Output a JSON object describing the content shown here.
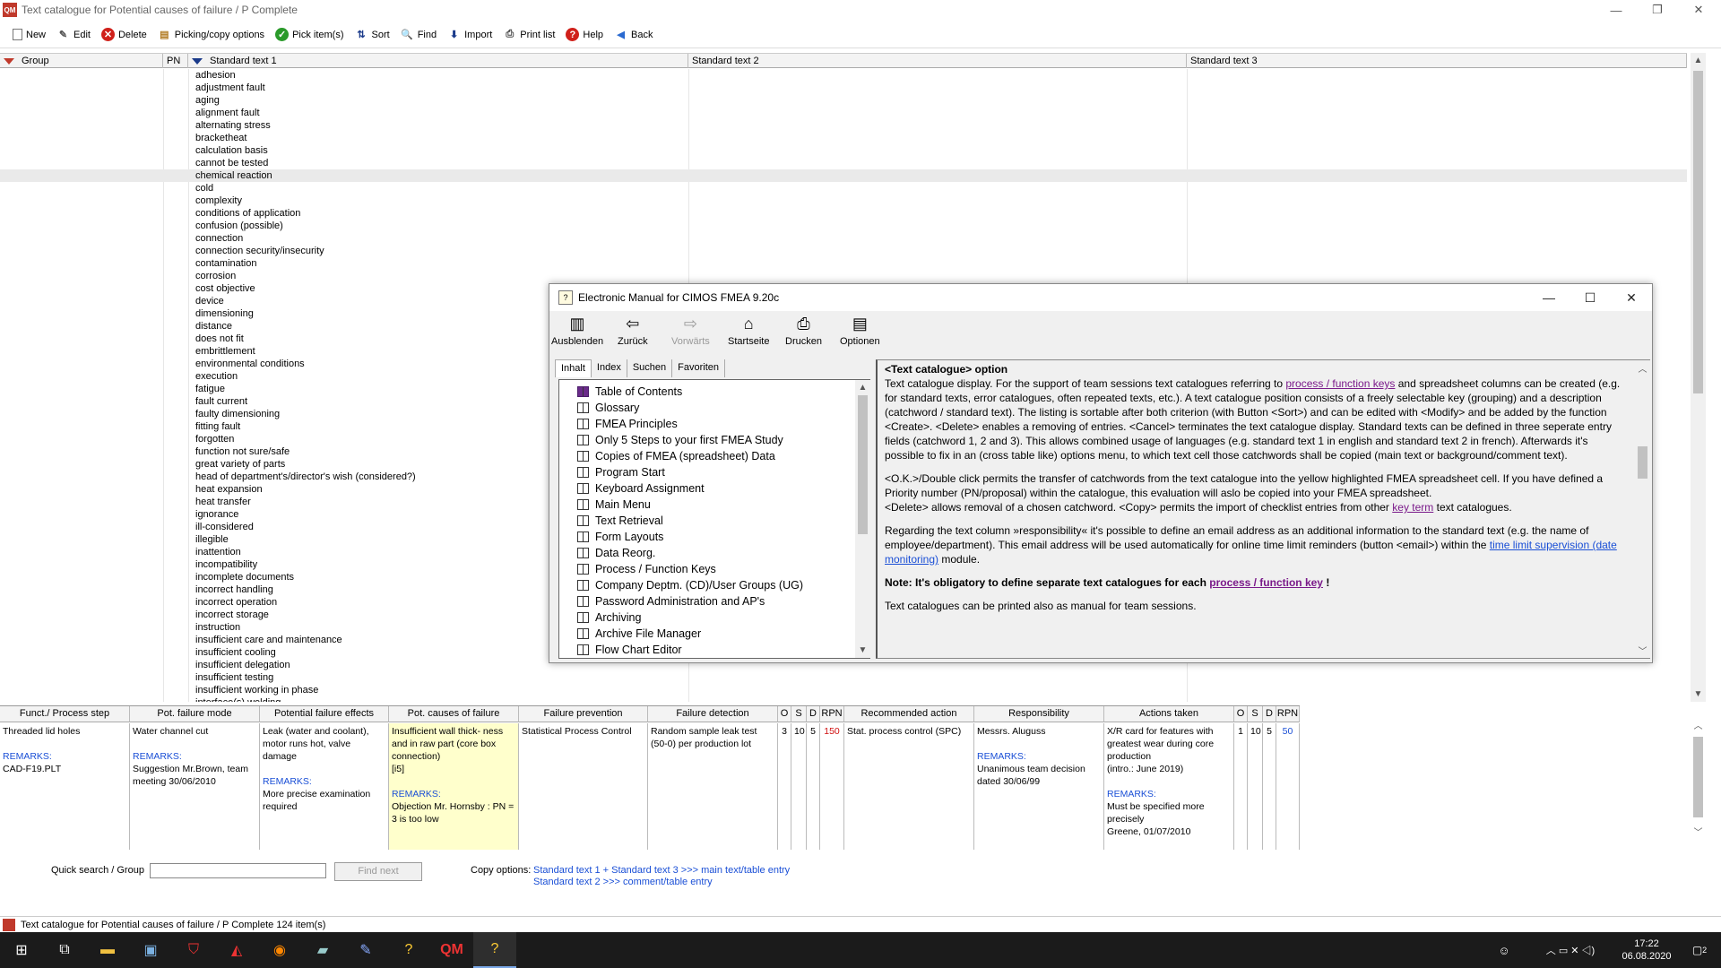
{
  "window": {
    "title": "Text catalogue for Potential causes of failure / P  Complete",
    "app_icon": "QM"
  },
  "toolbar": [
    {
      "label": "New",
      "icon": "new-icon"
    },
    {
      "label": "Edit",
      "icon": "edit-icon"
    },
    {
      "label": "Delete",
      "icon": "delete-icon"
    },
    {
      "label": "Picking/copy options",
      "icon": "picking-icon"
    },
    {
      "label": "Pick item(s)",
      "icon": "pick-icon"
    },
    {
      "label": "Sort",
      "icon": "sort-icon"
    },
    {
      "label": "Find",
      "icon": "find-icon"
    },
    {
      "label": "Import",
      "icon": "import-icon"
    },
    {
      "label": "Print list",
      "icon": "print-icon"
    },
    {
      "label": "Help",
      "icon": "help-icon"
    },
    {
      "label": "Back",
      "icon": "back-icon"
    }
  ],
  "grid": {
    "headers": {
      "group": "Group",
      "pn": "PN",
      "st1": "Standard text 1",
      "st2": "Standard text 2",
      "st3": "Standard text 3"
    },
    "rows": [
      "adhesion",
      "adjustment fault",
      "aging",
      "alignment fault",
      "alternating stress",
      "bracketheat",
      "calculation basis",
      "cannot be tested",
      "chemical reaction",
      "cold",
      "complexity",
      "conditions of application",
      "confusion (possible)",
      "connection",
      "connection security/insecurity",
      "contamination",
      "corrosion",
      "cost objective",
      "device",
      "dimensioning",
      "distance",
      "does not fit",
      "embrittlement",
      "environmental conditions",
      "execution",
      "fatigue",
      "fault current",
      "faulty dimensioning",
      "fitting fault",
      "forgotten",
      "function not sure/safe",
      "great variety of parts",
      "head of department's/director's wish (considered?)",
      "heat expansion",
      "heat transfer",
      "ignorance",
      "ill-considered",
      "illegible",
      "inattention",
      "incompatibility",
      "incomplete documents",
      "incorrect handling",
      "incorrect operation",
      "incorrect storage",
      "instruction",
      "insufficient care and maintenance",
      "insufficient cooling",
      "insufficient delegation",
      "insufficient testing",
      "insufficient working in phase",
      "interface(s) welding"
    ],
    "selected_index": 8
  },
  "help": {
    "title": "Electronic Manual for CIMOS FMEA 9.20c",
    "toolbar": [
      "Ausblenden",
      "Zurück",
      "Vorwärts",
      "Startseite",
      "Drucken",
      "Optionen"
    ],
    "tabs": [
      "Inhalt",
      "Index",
      "Suchen",
      "Favoriten"
    ],
    "toc": [
      "Table of Contents",
      "Glossary",
      "FMEA Principles",
      "Only 5 Steps to your first FMEA Study",
      "Copies of FMEA (spreadsheet) Data",
      "Program Start",
      "Keyboard Assignment",
      "Main Menu",
      "Text Retrieval",
      "Form Layouts",
      "Data Reorg.",
      "Process / Function Keys",
      "Company Deptm. (CD)/User Groups (UG)",
      "Password Administration and AP's",
      "Archiving",
      "Archive File Manager",
      "Flow Chart Editor"
    ],
    "content": {
      "heading": "<Text catalogue> option",
      "p1a": "Text catalogue display. For the support of team sessions text catalogues referring to ",
      "p1link": "process / function keys",
      "p1b": " and spreadsheet columns can be created (e.g. for standard texts, error catalogues, often repeated texts, etc.). A text catalogue position consists of a freely selectable key (grouping) and a description (catchword / standard text). The listing is sortable after both criterion (with Button <Sort>) and can be edited with <Modify> and be added by the function <Create>. <Delete> enables a removing of entries. <Cancel> terminates the text catalogue display. Standard texts can be defined in three seperate entry fields (catchword 1, 2 and 3). This allows combined usage of languages (e.g. standard text 1 in english and standard text 2 in french). Afterwards it's possible to fix in an (cross table like)  options menu, to which text cell those catchwords shall be copied (main text or background/comment text).",
      "p2a": "<O.K.>/Double click permits the transfer of catchwords from the text catalogue into the yellow highlighted FMEA spreadsheet cell. If you have defined a Priority number (PN/proposal) within the catalogue, this evaluation will aslo be copied into your FMEA spreadsheet.",
      "p2b": "<Delete> allows removal of a chosen catchword. <Copy> permits the import of checklist entries from other ",
      "p2link": "key term",
      "p2c": " text catalogues.",
      "p3a": "Regarding the text column »responsibility« it's possible to define an email address as an additional information to the standard text (e.g. the name of employee/department). This email address will be used automatically for online time limit reminders (button <email>) within the ",
      "p3link": "time limit supervision (date monitoring)",
      "p3b": " module.",
      "p4a": "Note: It's obligatory to define separate text catalogues for each ",
      "p4link": "process / function key",
      "p4b": " !",
      "p5": "Text catalogues can be printed also as manual for team sessions."
    }
  },
  "fmea": {
    "headers": [
      "Funct./ Process step",
      "Pot. failure mode",
      "Potential failure effects",
      "Pot. causes of failure",
      "Failure prevention",
      "Failure detection",
      "O",
      "S",
      "D",
      "RPN",
      "Recommended action",
      "Responsibility",
      "Actions taken",
      "O",
      "S",
      "D",
      "RPN"
    ],
    "cells": {
      "c0": "Threaded lid holes",
      "c0r": "REMARKS:",
      "c0b": "CAD-F19.PLT",
      "c1": "Water channel cut",
      "c1r": "REMARKS:",
      "c1b": "Suggestion Mr.Brown, team meeting 30/06/2010",
      "c2": "Leak (water and coolant), motor runs hot, valve damage",
      "c2r": "REMARKS:",
      "c2b": "More precise examination required",
      "c3": "Insufficient wall thick- ness and in raw part (core box connection)",
      "c3x": "[i5]",
      "c3r": "REMARKS:",
      "c3b": "Objection Mr. Hornsby : PN = 3 is too low",
      "c4": "Statistical Process Control",
      "c5": "Random sample leak test (50-0) per production lot",
      "o": "3",
      "s": "10",
      "d": "5",
      "rpn": "150",
      "c10": "Stat. process control (SPC)",
      "c11": "Messrs. Aluguss",
      "c11r": "REMARKS:",
      "c11b": "Unanimous team decision dated 30/06/99",
      "c12": "X/R card for features with greatest wear during core production",
      "c12x": "(intro.: June 2019)",
      "c12r": "REMARKS:",
      "c12b": "Must be specified more precisely",
      "c12c": "Greene, 01/07/2010",
      "o2": "1",
      "s2": "10",
      "d2": "5",
      "rpn2": "50"
    }
  },
  "search": {
    "label": "Quick search / Group",
    "value": "",
    "find_next": "Find next",
    "copy_label": "Copy options:",
    "copy1": "Standard text 1 + Standard text 3 >>> main text/table entry",
    "copy2": "Standard text 2 >>> comment/table entry"
  },
  "status": {
    "text": "Text catalogue for Potential causes of failure / P  Complete  124 item(s)"
  },
  "taskbar": {
    "time": "17:22",
    "date": "06.08.2020",
    "notif": "2"
  },
  "colors": {
    "accent": "#1a4fd6",
    "visited": "#7a1a8a",
    "rpn": "#d01010",
    "highlight": "#ffffcc"
  }
}
